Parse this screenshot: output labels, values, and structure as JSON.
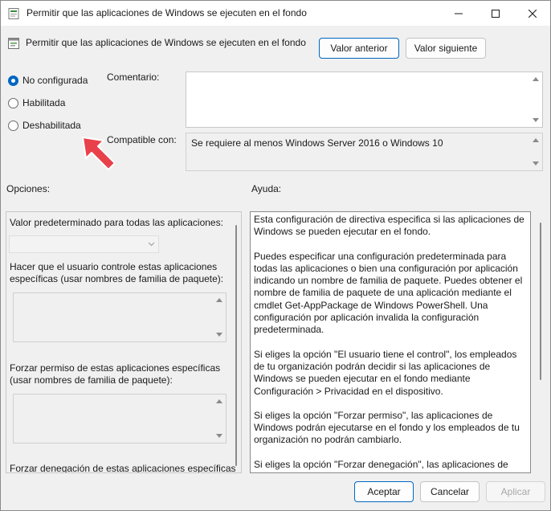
{
  "window": {
    "title": "Permitir que las aplicaciones de Windows se ejecuten en el fondo",
    "controls": {
      "minimize": "minimize-icon",
      "maximize": "maximize-icon",
      "close": "close-icon"
    }
  },
  "header": {
    "policy_title": "Permitir que las aplicaciones de Windows se ejecuten en el fondo",
    "prev_button": "Valor anterior",
    "next_button": "Valor siguiente"
  },
  "state": {
    "options": [
      {
        "label": "No configurada",
        "selected": true
      },
      {
        "label": "Habilitada",
        "selected": false
      },
      {
        "label": "Deshabilitada",
        "selected": false
      }
    ]
  },
  "comment": {
    "label": "Comentario:",
    "value": ""
  },
  "compat": {
    "label": "Compatible con:",
    "value": "Se requiere al menos Windows Server 2016 o Windows 10"
  },
  "options_panel": {
    "label": "Opciones:",
    "default_label": "Valor predeterminado para todas las aplicaciones:",
    "default_value": "",
    "user_control_label": "Hacer que el usuario controle estas aplicaciones específicas (usar nombres de familia de paquete):",
    "force_allow_label": "Forzar permiso de estas aplicaciones específicas (usar nombres de familia de paquete):",
    "force_deny_label": "Forzar denegación de estas aplicaciones específicas"
  },
  "help_panel": {
    "label": "Ayuda:",
    "paragraphs": [
      "Esta configuración de directiva especifica si las aplicaciones de Windows se pueden ejecutar en el fondo.",
      "Puedes especificar una configuración predeterminada para todas las aplicaciones o bien una configuración por aplicación indicando un nombre de familia de paquete. Puedes obtener el nombre de familia de paquete de una aplicación mediante el cmdlet Get-AppPackage de Windows PowerShell. Una configuración por aplicación invalida la configuración predeterminada.",
      "Si eliges la opción \"El usuario tiene el control\", los empleados de tu organización podrán decidir si las aplicaciones de Windows se pueden ejecutar en el fondo mediante Configuración > Privacidad en el dispositivo.",
      "Si eliges la opción \"Forzar permiso\", las aplicaciones de Windows podrán ejecutarse en el fondo y los empleados de tu organización no podrán cambiarlo.",
      "Si eliges la opción \"Forzar denegación\", las aplicaciones de"
    ]
  },
  "footer": {
    "ok": "Aceptar",
    "cancel": "Cancelar",
    "apply": "Aplicar"
  },
  "colors": {
    "accent": "#0067c0",
    "annotation_arrow": "#e8414b"
  }
}
